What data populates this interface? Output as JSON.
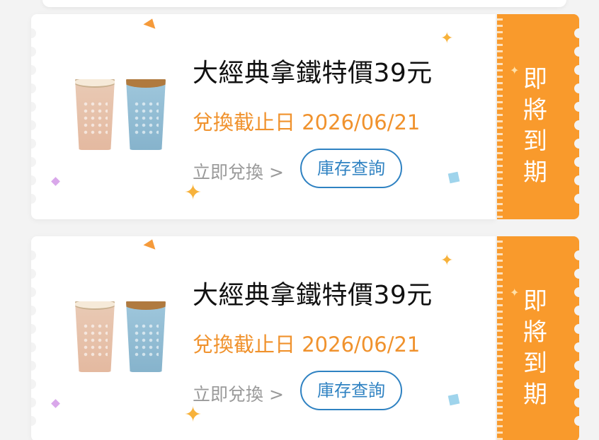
{
  "coupons": [
    {
      "title": "大經典拿鐵特價39元",
      "deadline": "兌換截止日 2026/06/21",
      "redeem_label": "立即兌換 >",
      "stock_button_label": "庫存查詢",
      "stub_label": [
        "即",
        "將",
        "到",
        "期"
      ]
    },
    {
      "title": "大經典拿鐵特價39元",
      "deadline": "兌換截止日 2026/06/21",
      "redeem_label": "立即兌換 >",
      "stock_button_label": "庫存查詢",
      "stub_label": [
        "即",
        "將",
        "到",
        "期"
      ]
    }
  ],
  "colors": {
    "accent_orange": "#f99a2c",
    "deadline_orange": "#f0922d",
    "button_blue": "#2f82c2"
  },
  "icons": {
    "product": "latte-and-iced-coffee-cups",
    "decoration": "confetti-stars"
  }
}
